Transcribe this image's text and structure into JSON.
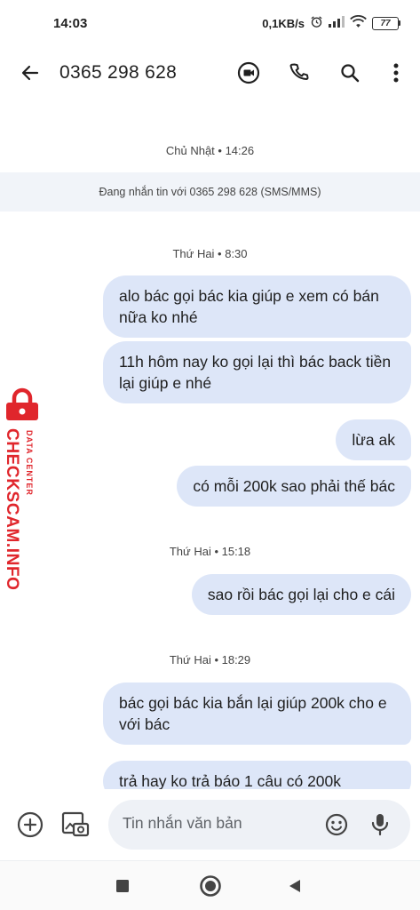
{
  "status_bar": {
    "time": "14:03",
    "network_speed": "0,1KB/s",
    "battery_level": "77",
    "icons": [
      "alarm-icon",
      "signal-icon",
      "wifi-icon",
      "battery-icon"
    ]
  },
  "app_bar": {
    "title": "0365 298 628",
    "icons": [
      "back-arrow-icon",
      "video-call-icon",
      "phone-icon",
      "search-icon",
      "more-vert-icon"
    ]
  },
  "conversation": {
    "date_sep_1": "Chủ Nhật • 14:26",
    "info_banner": "Đang nhắn tin với 0365 298 628 (SMS/MMS)",
    "date_sep_2": "Thứ Hai • 8:30",
    "msg_1": "alo bác gọi bác kia giúp e xem có bán nữa ko nhé",
    "msg_2": "11h hôm nay ko gọi lại thì bác back tiền lại giúp e nhé",
    "msg_3": "lừa ak",
    "msg_4": "có mỗi 200k sao phải thế bác",
    "date_sep_3": "Thứ Hai • 15:18",
    "msg_5": "sao rồi bác gọi lại cho e cái",
    "date_sep_4": "Thứ Hai • 18:29",
    "msg_6": "bác gọi bác kia bắn lại giúp 200k cho e với bác",
    "msg_7": "trả hay ko trả báo 1 câu có 200k"
  },
  "watermark": {
    "line_1": "DATA CENTER",
    "line_2": "CHECKSCAM.INFO",
    "color": "#e0262c"
  },
  "compose": {
    "placeholder": "Tin nhắn văn bản",
    "value": "",
    "icons": [
      "add-circle-icon",
      "gallery-icon",
      "emoji-icon",
      "mic-icon"
    ]
  },
  "nav_bar": {
    "icons": [
      "recents-square-icon",
      "home-circle-icon",
      "back-triangle-icon"
    ]
  },
  "colors": {
    "bubble": "#dde6f8",
    "banner": "#f1f4f9",
    "compose_field": "#eef1f6"
  }
}
